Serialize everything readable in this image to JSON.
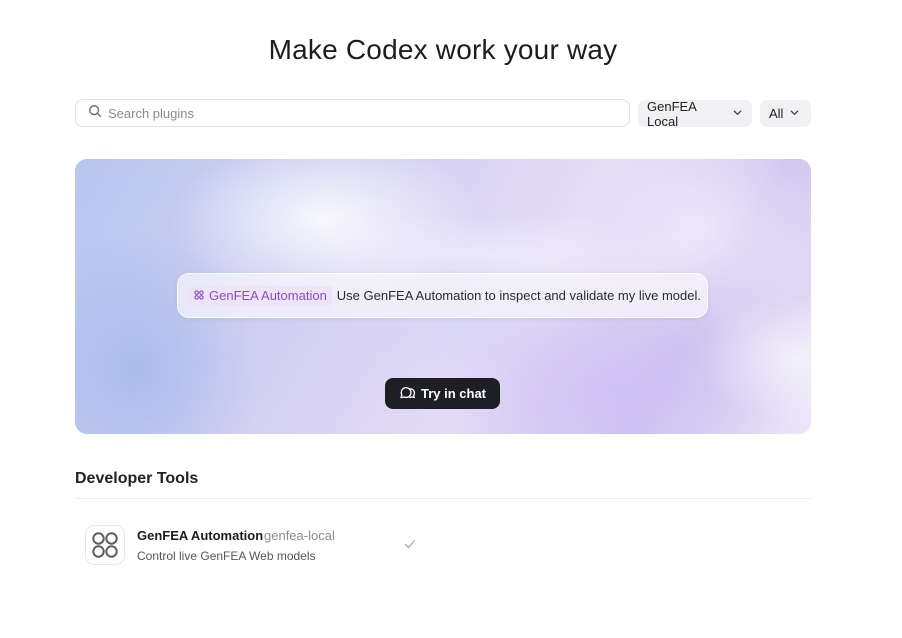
{
  "page": {
    "title": "Make Codex work your way"
  },
  "search": {
    "placeholder": "Search plugins",
    "value": ""
  },
  "filters": {
    "source": "GenFEA Local",
    "category": "All"
  },
  "hero": {
    "mention_label": "GenFEA Automation",
    "prompt_text": "Use GenFEA Automation to inspect and validate my live model.",
    "cta_label": "Try in chat"
  },
  "sections": [
    {
      "title": "Developer Tools",
      "plugins": [
        {
          "name": "GenFEA Automation",
          "id": "genfea-local",
          "description": "Control live GenFEA Web models",
          "installed": true
        }
      ]
    }
  ],
  "colors": {
    "accent_mention_text": "#8a4fc4",
    "accent_mention_bg": "#ece4f8",
    "cta_bg": "#1e1f24"
  }
}
